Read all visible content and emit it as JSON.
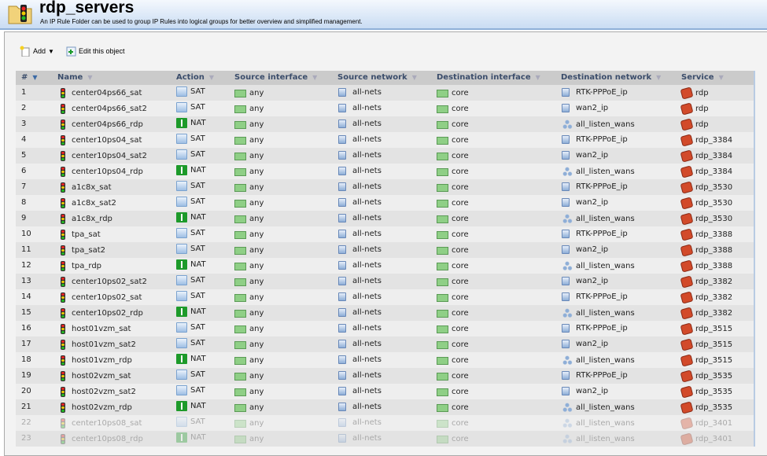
{
  "header": {
    "title": "rdp_servers",
    "subtitle": "An IP Rule Folder can be used to group IP Rules into logical groups for better overview and simplified management."
  },
  "toolbar": {
    "add_label": "Add",
    "edit_label": "Edit this object"
  },
  "columns": [
    "#",
    "Name",
    "Action",
    "Source interface",
    "Source network",
    "Destination interface",
    "Destination network",
    "Service"
  ],
  "rows": [
    {
      "n": "1",
      "name": "center04ps66_sat",
      "action": "SAT",
      "src_if": "any",
      "src_net": "all-nets",
      "dst_if": "core",
      "dst_net": "RTK-PPPoE_ip",
      "service": "rdp",
      "disabled": false
    },
    {
      "n": "2",
      "name": "center04ps66_sat2",
      "action": "SAT",
      "src_if": "any",
      "src_net": "all-nets",
      "dst_if": "core",
      "dst_net": "wan2_ip",
      "service": "rdp",
      "disabled": false
    },
    {
      "n": "3",
      "name": "center04ps66_rdp",
      "action": "NAT",
      "src_if": "any",
      "src_net": "all-nets",
      "dst_if": "core",
      "dst_net": "all_listen_wans",
      "service": "rdp",
      "disabled": false
    },
    {
      "n": "4",
      "name": "center10ps04_sat",
      "action": "SAT",
      "src_if": "any",
      "src_net": "all-nets",
      "dst_if": "core",
      "dst_net": "RTK-PPPoE_ip",
      "service": "rdp_3384",
      "disabled": false
    },
    {
      "n": "5",
      "name": "center10ps04_sat2",
      "action": "SAT",
      "src_if": "any",
      "src_net": "all-nets",
      "dst_if": "core",
      "dst_net": "wan2_ip",
      "service": "rdp_3384",
      "disabled": false
    },
    {
      "n": "6",
      "name": "center10ps04_rdp",
      "action": "NAT",
      "src_if": "any",
      "src_net": "all-nets",
      "dst_if": "core",
      "dst_net": "all_listen_wans",
      "service": "rdp_3384",
      "disabled": false
    },
    {
      "n": "7",
      "name": "a1c8x_sat",
      "action": "SAT",
      "src_if": "any",
      "src_net": "all-nets",
      "dst_if": "core",
      "dst_net": "RTK-PPPoE_ip",
      "service": "rdp_3530",
      "disabled": false
    },
    {
      "n": "8",
      "name": "a1c8x_sat2",
      "action": "SAT",
      "src_if": "any",
      "src_net": "all-nets",
      "dst_if": "core",
      "dst_net": "wan2_ip",
      "service": "rdp_3530",
      "disabled": false
    },
    {
      "n": "9",
      "name": "a1c8x_rdp",
      "action": "NAT",
      "src_if": "any",
      "src_net": "all-nets",
      "dst_if": "core",
      "dst_net": "all_listen_wans",
      "service": "rdp_3530",
      "disabled": false
    },
    {
      "n": "10",
      "name": "tpa_sat",
      "action": "SAT",
      "src_if": "any",
      "src_net": "all-nets",
      "dst_if": "core",
      "dst_net": "RTK-PPPoE_ip",
      "service": "rdp_3388",
      "disabled": false
    },
    {
      "n": "11",
      "name": "tpa_sat2",
      "action": "SAT",
      "src_if": "any",
      "src_net": "all-nets",
      "dst_if": "core",
      "dst_net": "wan2_ip",
      "service": "rdp_3388",
      "disabled": false
    },
    {
      "n": "12",
      "name": "tpa_rdp",
      "action": "NAT",
      "src_if": "any",
      "src_net": "all-nets",
      "dst_if": "core",
      "dst_net": "all_listen_wans",
      "service": "rdp_3388",
      "disabled": false
    },
    {
      "n": "13",
      "name": "center10ps02_sat2",
      "action": "SAT",
      "src_if": "any",
      "src_net": "all-nets",
      "dst_if": "core",
      "dst_net": "wan2_ip",
      "service": "rdp_3382",
      "disabled": false
    },
    {
      "n": "14",
      "name": "center10ps02_sat",
      "action": "SAT",
      "src_if": "any",
      "src_net": "all-nets",
      "dst_if": "core",
      "dst_net": "RTK-PPPoE_ip",
      "service": "rdp_3382",
      "disabled": false
    },
    {
      "n": "15",
      "name": "center10ps02_rdp",
      "action": "NAT",
      "src_if": "any",
      "src_net": "all-nets",
      "dst_if": "core",
      "dst_net": "all_listen_wans",
      "service": "rdp_3382",
      "disabled": false
    },
    {
      "n": "16",
      "name": "host01vzm_sat",
      "action": "SAT",
      "src_if": "any",
      "src_net": "all-nets",
      "dst_if": "core",
      "dst_net": "RTK-PPPoE_ip",
      "service": "rdp_3515",
      "disabled": false
    },
    {
      "n": "17",
      "name": "host01vzm_sat2",
      "action": "SAT",
      "src_if": "any",
      "src_net": "all-nets",
      "dst_if": "core",
      "dst_net": "wan2_ip",
      "service": "rdp_3515",
      "disabled": false
    },
    {
      "n": "18",
      "name": "host01vzm_rdp",
      "action": "NAT",
      "src_if": "any",
      "src_net": "all-nets",
      "dst_if": "core",
      "dst_net": "all_listen_wans",
      "service": "rdp_3515",
      "disabled": false
    },
    {
      "n": "19",
      "name": "host02vzm_sat",
      "action": "SAT",
      "src_if": "any",
      "src_net": "all-nets",
      "dst_if": "core",
      "dst_net": "RTK-PPPoE_ip",
      "service": "rdp_3535",
      "disabled": false
    },
    {
      "n": "20",
      "name": "host02vzm_sat2",
      "action": "SAT",
      "src_if": "any",
      "src_net": "all-nets",
      "dst_if": "core",
      "dst_net": "wan2_ip",
      "service": "rdp_3535",
      "disabled": false
    },
    {
      "n": "21",
      "name": "host02vzm_rdp",
      "action": "NAT",
      "src_if": "any",
      "src_net": "all-nets",
      "dst_if": "core",
      "dst_net": "all_listen_wans",
      "service": "rdp_3535",
      "disabled": false
    },
    {
      "n": "22",
      "name": "center10ps08_sat",
      "action": "SAT",
      "src_if": "any",
      "src_net": "all-nets",
      "dst_if": "core",
      "dst_net": "all_listen_wans",
      "service": "rdp_3401",
      "disabled": true
    },
    {
      "n": "23",
      "name": "center10ps08_rdp",
      "action": "NAT",
      "src_if": "any",
      "src_net": "all-nets",
      "dst_if": "core",
      "dst_net": "all_listen_wans",
      "service": "rdp_3401",
      "disabled": true
    }
  ]
}
